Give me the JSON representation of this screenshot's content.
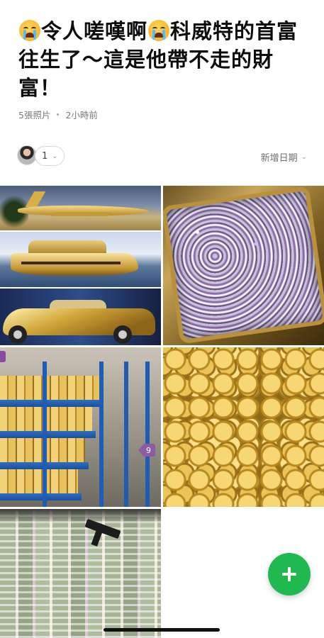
{
  "post": {
    "title_part1": "令人嗟嘆啊",
    "title_part2": "科威特的首富往生了～這是他帶不走的財富！",
    "photo_count": "5張照片",
    "time_ago": "2小時前"
  },
  "controls": {
    "participant_count": "1",
    "sort_label": "新增日期"
  },
  "album": {
    "photos": [
      {
        "subject": "gold-jet"
      },
      {
        "subject": "gold-yacht"
      },
      {
        "subject": "gold-car"
      },
      {
        "subject": "gemstones-tray"
      },
      {
        "subject": "gold-bars-warehouse"
      },
      {
        "subject": "gold-coins"
      },
      {
        "subject": "cash-stacks"
      }
    ],
    "more_badge": "9"
  },
  "icons": {
    "title_emoji": "crying-face-icon",
    "fab": "plus-icon",
    "chevron": "chevron-down-icon"
  },
  "colors": {
    "fab": "#1fb950",
    "badge": "#8d5aa3"
  }
}
